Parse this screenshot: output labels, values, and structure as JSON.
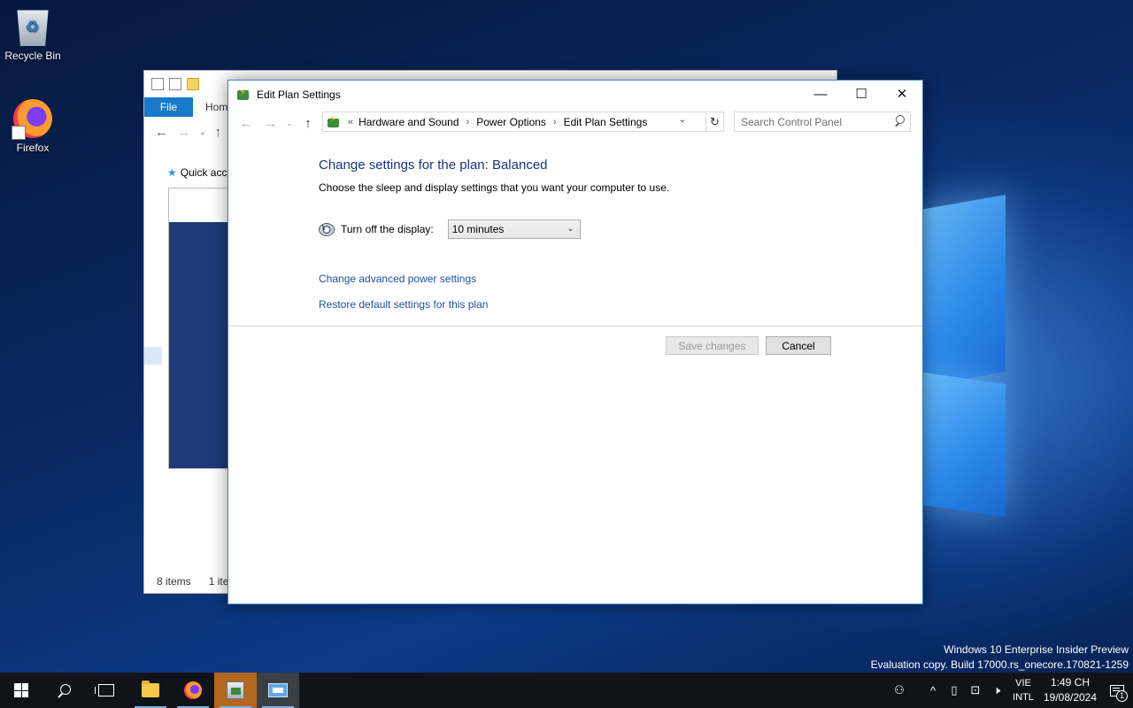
{
  "desktop": {
    "icons": [
      {
        "label": "Recycle Bin",
        "icon": "recycle-bin-icon"
      },
      {
        "label": "Firefox",
        "icon": "firefox-icon"
      }
    ],
    "watermark": {
      "line1": "Windows 10 Enterprise Insider Preview",
      "line2": "Evaluation copy. Build 17000.rs_onecore.170821-1259"
    }
  },
  "explorer": {
    "file_tab": "File",
    "home_tab": "Hom",
    "quick_access": "Quick acc",
    "status_items": "8 items",
    "status_selected": "1 ite"
  },
  "window": {
    "title": "Edit Plan Settings",
    "controls": {
      "minimize": "—",
      "maximize": "☐",
      "close": "✕"
    },
    "breadcrumb": {
      "overflow": "«",
      "items": [
        "Hardware and Sound",
        "Power Options",
        "Edit Plan Settings"
      ]
    },
    "search": {
      "placeholder": "Search Control Panel"
    },
    "heading": "Change settings for the plan: Balanced",
    "subtext": "Choose the sleep and display settings that you want your computer to use.",
    "display_label": "Turn off the display:",
    "display_value": "10 minutes",
    "links": {
      "advanced": "Change advanced power settings",
      "restore": "Restore default settings for this plan"
    },
    "buttons": {
      "save": "Save changes",
      "cancel": "Cancel"
    }
  },
  "taskbar": {
    "apps": [
      "File Explorer",
      "Firefox",
      "Control Panel",
      "Remote Desktop"
    ],
    "tray": {
      "lang_line1": "VIE",
      "lang_line2": "INTL",
      "time": "1:49 CH",
      "date": "19/08/2024",
      "notification_count": "1"
    }
  },
  "colors": {
    "heading": "#1e3287",
    "link": "#1f4fa6",
    "file_tab": "#1979ca",
    "taskbar": "#101418"
  }
}
